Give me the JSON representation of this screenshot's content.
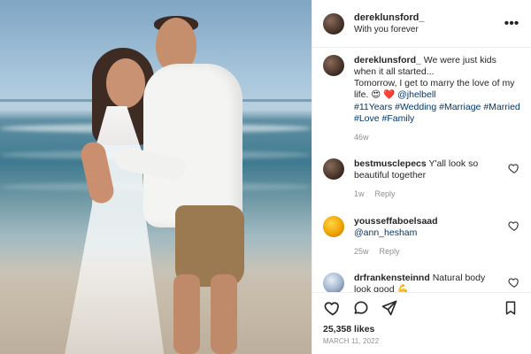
{
  "post": {
    "header": {
      "username": "dereklunsford_",
      "subtitle": "With you forever"
    },
    "caption": {
      "username": "dereklunsford_",
      "text_line1": "We were just kids when it all started...",
      "text_line2": "Tomorrow, I get to marry the love of my life.",
      "emoji1": "😍",
      "emoji2": "❤️",
      "mention": "@jhelbell",
      "hashtags": "#11Years #Wedding #Marriage #Married #Love #Family",
      "time": "46w"
    },
    "comments": [
      {
        "username": "bestmusclepecs",
        "text": "Y'all look so beautiful together",
        "time": "1w",
        "reply": "Reply"
      },
      {
        "username": "yousseffaboelsaad",
        "text": "@ann_hesham",
        "time": "25w",
        "reply": "Reply"
      },
      {
        "username": "drfrankensteinnd",
        "text": "Natural body look good",
        "emoji": "💪"
      }
    ],
    "engagement": {
      "likes": "25,358 likes",
      "date": "MARCH 11, 2022"
    },
    "icons": {
      "more": "more-icon",
      "like": "heart-icon",
      "comment": "comment-icon",
      "share": "share-icon",
      "save": "bookmark-icon"
    }
  }
}
